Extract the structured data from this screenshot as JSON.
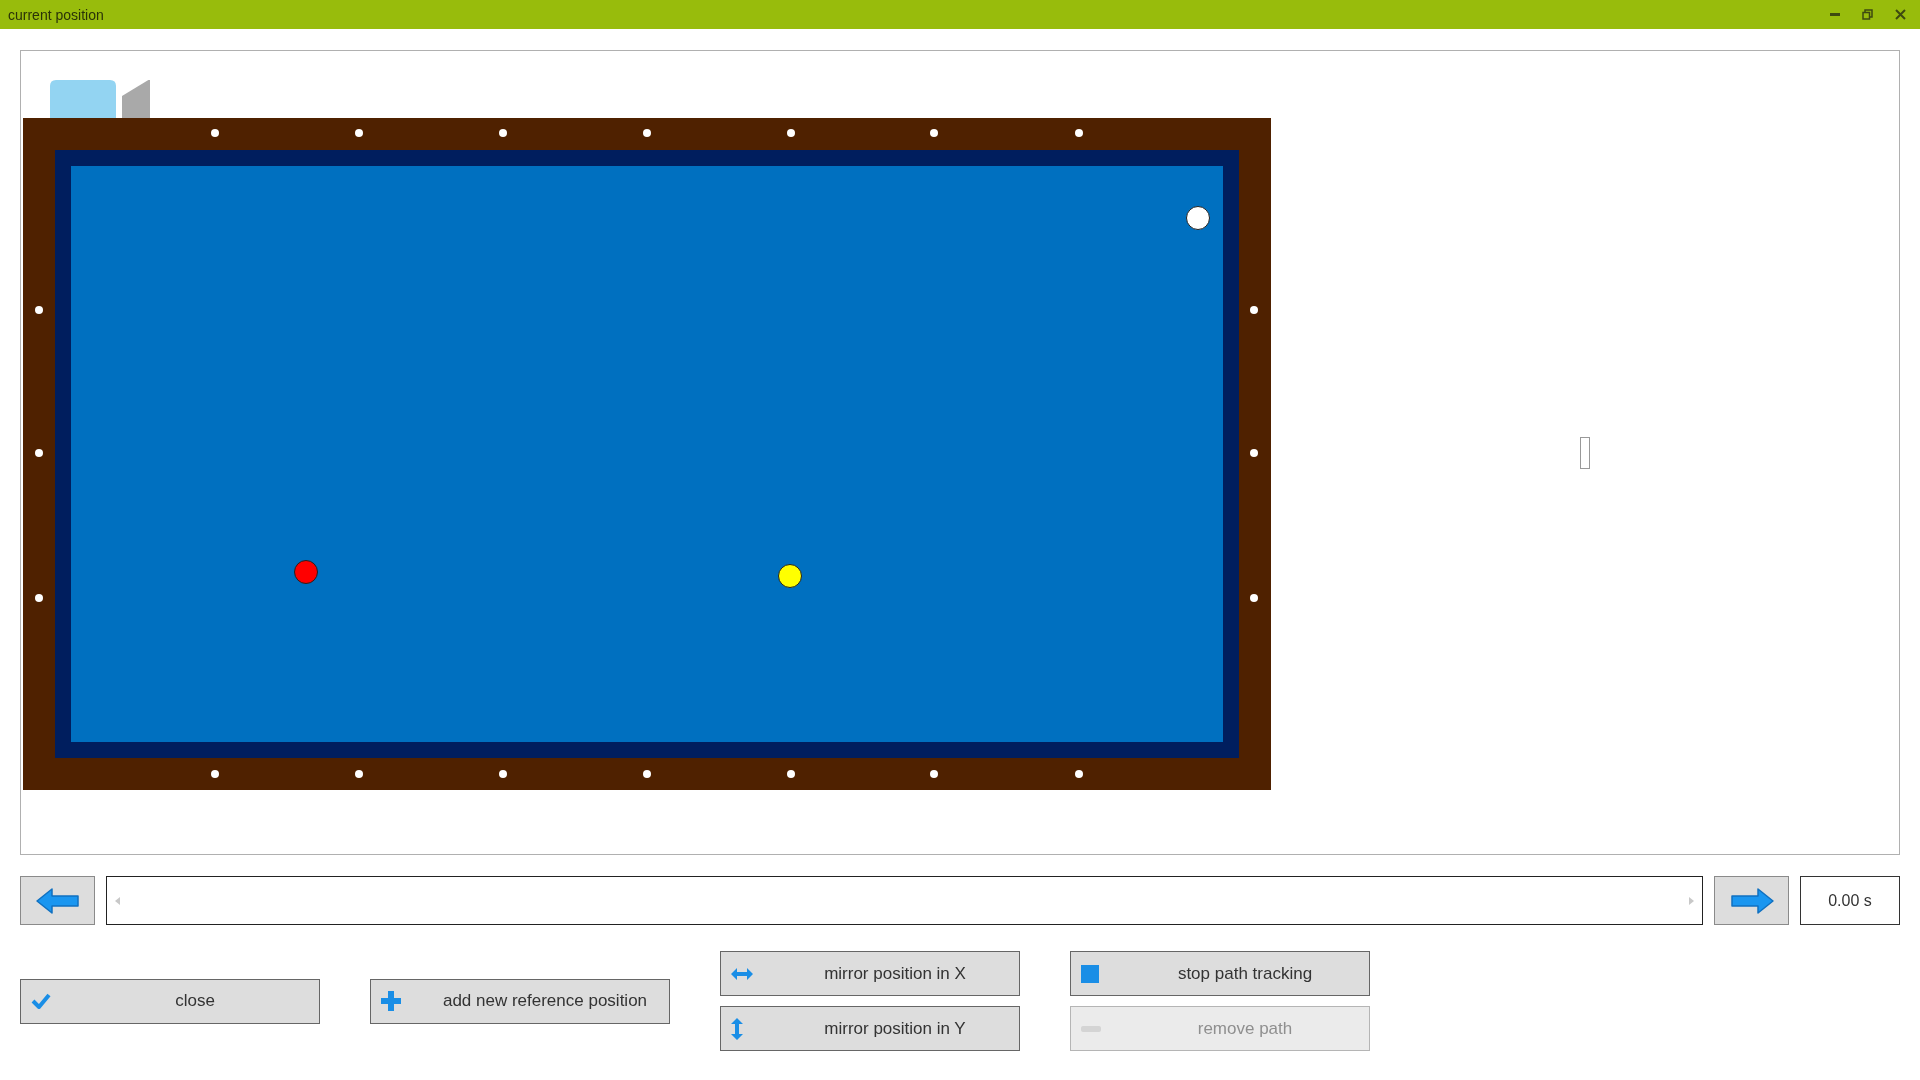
{
  "window": {
    "title": "current position"
  },
  "table": {
    "balls": [
      {
        "color": "#ffffff"
      },
      {
        "color": "#ff0000"
      },
      {
        "color": "#ffff00"
      }
    ]
  },
  "timeline": {
    "level": 0,
    "time": "0.00 s"
  },
  "buttons": [
    {
      "kind": "close",
      "label": "close",
      "disabled": false
    },
    {
      "kind": "add",
      "label": "add new reference position",
      "disabled": false
    },
    {
      "kind": "mirror-x",
      "label": "mirror position in X",
      "disabled": false
    },
    {
      "kind": "mirror-y",
      "label": "mirror position in Y",
      "disabled": false
    },
    {
      "kind": "stop",
      "label": "stop path tracking",
      "disabled": false
    },
    {
      "kind": "remove",
      "label": "remove path",
      "disabled": true
    }
  ]
}
